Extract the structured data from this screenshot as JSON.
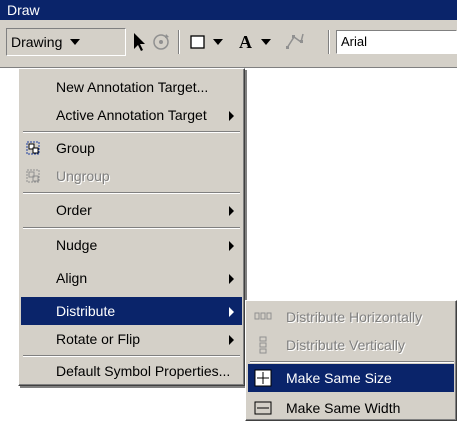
{
  "window": {
    "title": "Draw"
  },
  "toolbar": {
    "drawing_label": "Drawing",
    "font_value": "Arial"
  },
  "menu": {
    "items": [
      {
        "label": "New Annotation Target...",
        "submenu": false,
        "disabled": false
      },
      {
        "label": "Active Annotation Target",
        "submenu": true,
        "disabled": false
      },
      {
        "label": "Group",
        "submenu": false,
        "disabled": false,
        "icon": "group-icon"
      },
      {
        "label": "Ungroup",
        "submenu": false,
        "disabled": true,
        "icon": "ungroup-icon"
      },
      {
        "label": "Order",
        "submenu": true,
        "disabled": false
      },
      {
        "label": "Nudge",
        "submenu": true,
        "disabled": false
      },
      {
        "label": "Align",
        "submenu": true,
        "disabled": false
      },
      {
        "label": "Distribute",
        "submenu": true,
        "disabled": false,
        "highlighted": true
      },
      {
        "label": "Rotate or Flip",
        "submenu": true,
        "disabled": false
      },
      {
        "label": "Default Symbol Properties...",
        "submenu": false,
        "disabled": false
      }
    ]
  },
  "submenu": {
    "items": [
      {
        "label": "Distribute Horizontally",
        "disabled": true,
        "icon": "distribute-horizontally-icon"
      },
      {
        "label": "Distribute Vertically",
        "disabled": true,
        "icon": "distribute-vertically-icon"
      },
      {
        "label": "Make Same Size",
        "disabled": false,
        "highlighted": true,
        "icon": "make-same-size-icon"
      },
      {
        "label": "Make Same Width",
        "disabled": false,
        "icon": "make-same-width-icon"
      }
    ]
  },
  "colors": {
    "highlight": "#0a246a",
    "face": "#d4d0c8",
    "disabled": "#808080"
  }
}
